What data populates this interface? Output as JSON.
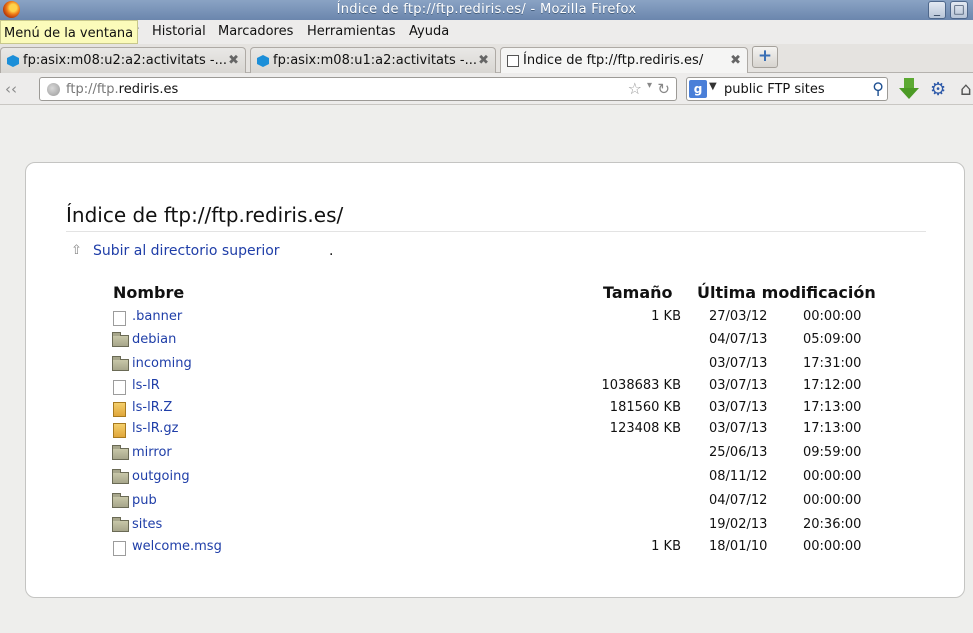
{
  "window": {
    "title": "Índice de ftp://ftp.rediris.es/ - Mozilla Firefox",
    "minimize": "_",
    "maximize": "□"
  },
  "menu": {
    "tooltip": "Menú de la ventana",
    "items": [
      "r",
      "Historial",
      "Marcadores",
      "Herramientas",
      "Ayuda"
    ]
  },
  "tabs": [
    {
      "label": "fp:asix:m08:u2:a2:activitats -...",
      "close": "✖"
    },
    {
      "label": "fp:asix:m08:u1:a2:activitats -...",
      "close": "✖"
    },
    {
      "label": "Índice de ftp://ftp.rediris.es/",
      "close": "✖"
    }
  ],
  "newtab": "+",
  "nav": {
    "url_prefix": "ftp://ftp.",
    "url_host": "rediris.es",
    "search_engine": "g",
    "search_query": "public FTP sites"
  },
  "page": {
    "heading": "Índice de ftp://ftp.rediris.es/",
    "up_link": "Subir al directorio superior",
    "up_dot": ".",
    "columns": {
      "name": "Nombre",
      "size": "Tamaño",
      "modified": "Última modificación"
    },
    "files": [
      {
        "icon": "file",
        "name": ".banner",
        "size": "1 KB",
        "date": "27/03/12",
        "time": "00:00:00"
      },
      {
        "icon": "folder",
        "name": "debian",
        "size": "",
        "date": "04/07/13",
        "time": "05:09:00"
      },
      {
        "icon": "folder",
        "name": "incoming",
        "size": "",
        "date": "03/07/13",
        "time": "17:31:00"
      },
      {
        "icon": "file",
        "name": "ls-lR",
        "size": "1038683 KB",
        "date": "03/07/13",
        "time": "17:12:00"
      },
      {
        "icon": "archive",
        "name": "ls-lR.Z",
        "size": "181560 KB",
        "date": "03/07/13",
        "time": "17:13:00"
      },
      {
        "icon": "archive",
        "name": "ls-lR.gz",
        "size": "123408 KB",
        "date": "03/07/13",
        "time": "17:13:00"
      },
      {
        "icon": "folder",
        "name": "mirror",
        "size": "",
        "date": "25/06/13",
        "time": "09:59:00"
      },
      {
        "icon": "folder",
        "name": "outgoing",
        "size": "",
        "date": "08/11/12",
        "time": "00:00:00"
      },
      {
        "icon": "folder",
        "name": "pub",
        "size": "",
        "date": "04/07/12",
        "time": "00:00:00"
      },
      {
        "icon": "folder",
        "name": "sites",
        "size": "",
        "date": "19/02/13",
        "time": "20:36:00"
      },
      {
        "icon": "file",
        "name": "welcome.msg",
        "size": "1 KB",
        "date": "18/01/10",
        "time": "00:00:00"
      }
    ]
  }
}
